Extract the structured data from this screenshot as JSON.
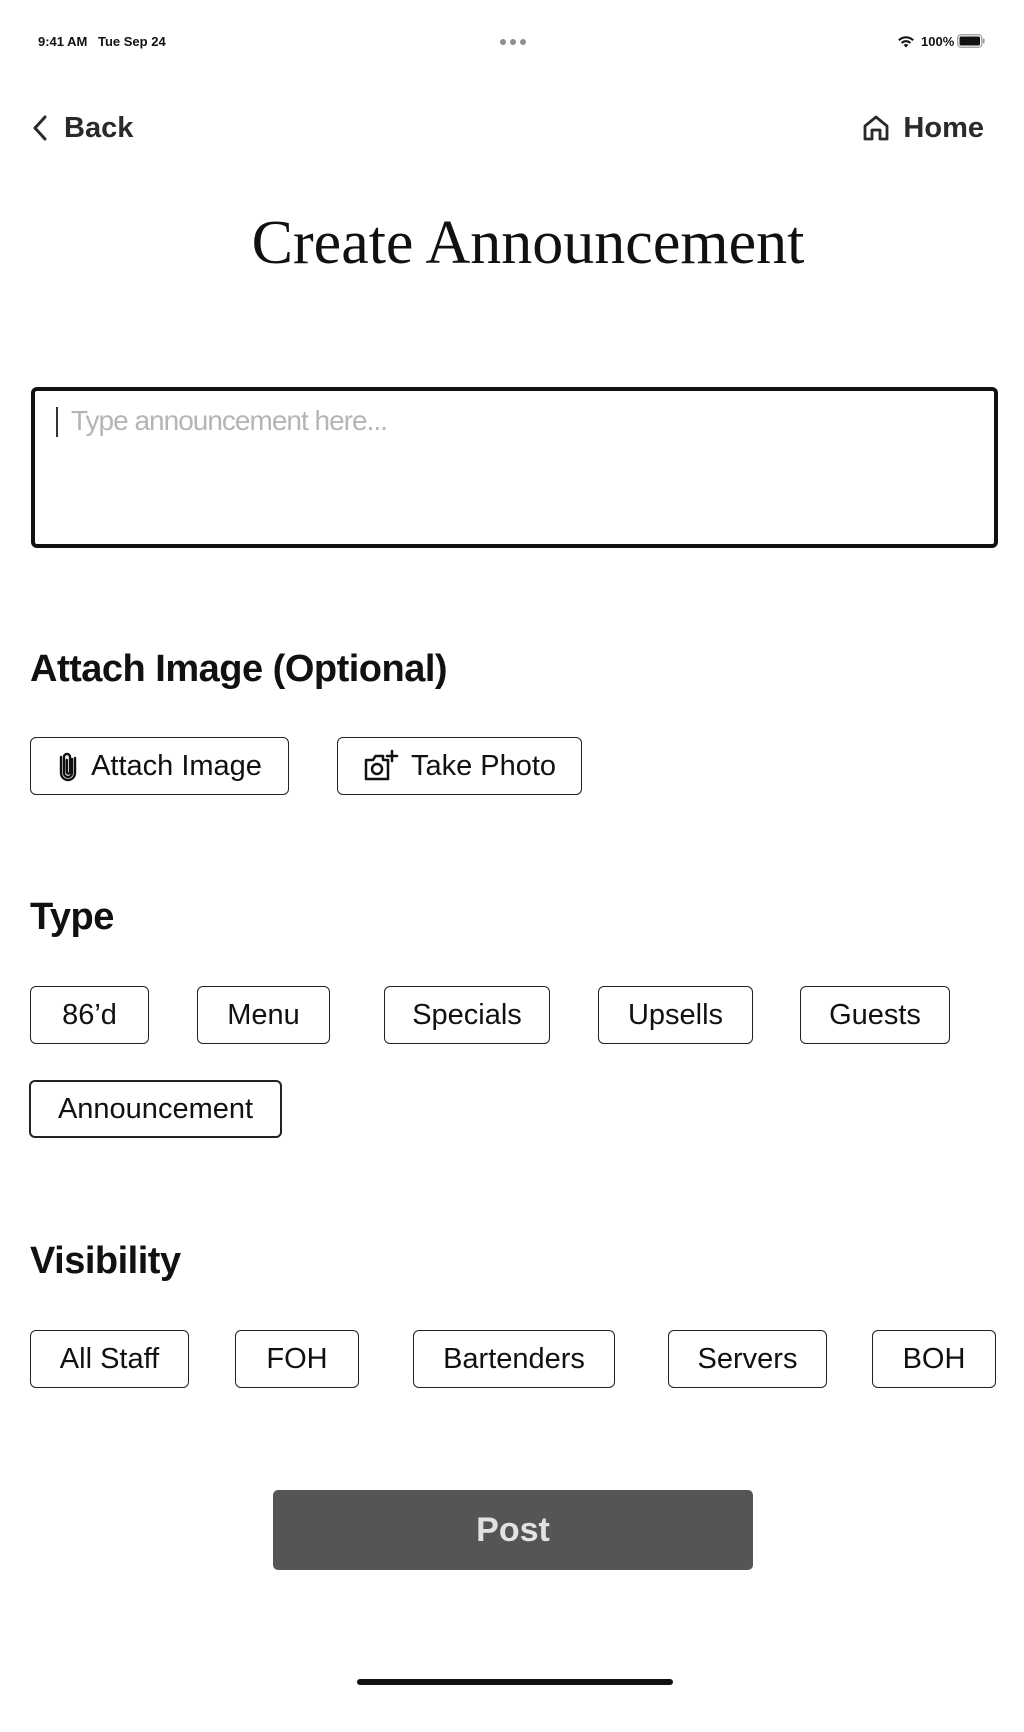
{
  "status_bar": {
    "time": "9:41 AM",
    "date": "Tue Sep 24",
    "battery": "100%"
  },
  "nav": {
    "back_label": "Back",
    "home_label": "Home"
  },
  "page": {
    "title": "Create Announcement"
  },
  "announcement": {
    "placeholder": "Type announcement here...",
    "value": ""
  },
  "attach_section": {
    "title": "Attach Image (Optional)",
    "attach_label": "Attach Image",
    "attach_icon": "paperclip-icon",
    "photo_label": "Take Photo",
    "photo_icon": "camera-plus-icon"
  },
  "type_section": {
    "title": "Type",
    "options": [
      "86’d",
      "Menu",
      "Specials",
      "Upsells",
      "Guests",
      "Announcement"
    ]
  },
  "visibility_section": {
    "title": "Visibility",
    "options": [
      "All Staff",
      "FOH",
      "Bartenders",
      "Servers",
      "BOH"
    ]
  },
  "post": {
    "label": "Post"
  },
  "colors": {
    "post_bg": "#555555",
    "post_text": "#e2e2e2",
    "placeholder": "#b5b5b5"
  }
}
